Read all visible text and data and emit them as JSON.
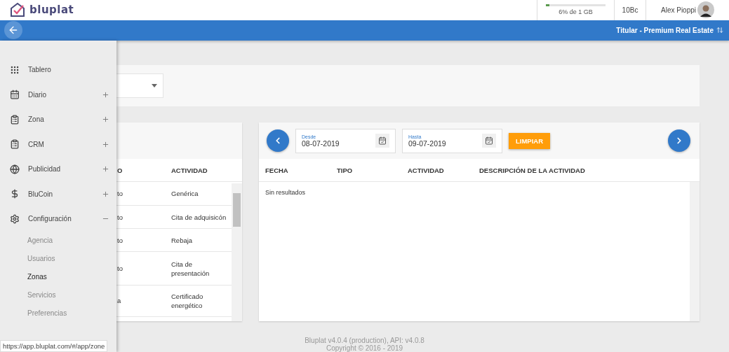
{
  "header": {
    "logo_text": "bluplat",
    "storage": {
      "label": "6% de 1 GB",
      "level": 0.06
    },
    "coins": "10Bc",
    "user": {
      "name": "Alex Pioppi"
    }
  },
  "nav_bar": {
    "title": "Titular - Premium Real Estate"
  },
  "sidebar": {
    "items": [
      {
        "label": "Tablero",
        "kind": "grid"
      },
      {
        "label": "Diario",
        "kind": "calendar",
        "expanded": false
      },
      {
        "label": "Zona",
        "kind": "clipboard",
        "expanded": false
      },
      {
        "label": "CRM",
        "kind": "clipboard",
        "expanded": false
      },
      {
        "label": "Publicidad",
        "kind": "globe",
        "expanded": false
      },
      {
        "label": "BluCoin",
        "kind": "dollar",
        "expanded": false
      },
      {
        "label": "Configuración",
        "kind": "gear",
        "expanded": true,
        "children": [
          {
            "label": "Agencia",
            "selected": false
          },
          {
            "label": "Usuarios",
            "selected": false
          },
          {
            "label": "Zonas",
            "selected": true
          },
          {
            "label": "Servicios",
            "selected": false
          },
          {
            "label": "Preferencias",
            "selected": false
          }
        ]
      }
    ]
  },
  "left_table": {
    "columns": [
      "O",
      "ACTIVIDAD"
    ],
    "rows": [
      {
        "column_1": "to",
        "actividad": "Genérica"
      },
      {
        "column_1": "to",
        "actividad": "Cita de adquisicón"
      },
      {
        "column_1": "to",
        "actividad": "Rebaja"
      },
      {
        "column_1": "to",
        "actividad": "Cita de presentación"
      },
      {
        "column_1": "a",
        "actividad": "Certificado energético"
      }
    ]
  },
  "activity_panel": {
    "date_from": {
      "label": "Desde",
      "value": "08-07-2019"
    },
    "date_to": {
      "label": "Hasta",
      "value": "09-07-2019"
    },
    "clear_button": "LIMPIAR",
    "columns": [
      "FECHA",
      "TIPO",
      "ACTIVIDAD",
      "DESCRIPCIÓN DE LA ACTIVIDAD"
    ],
    "empty_message": "Sin resultados"
  },
  "footer": {
    "version": "Bluplat v4.0.4 (production), API: v4.0.8",
    "copyright": "Copyright © 2016 - 2019"
  },
  "status_url": "https://app.bluplat.com/#/app/zone"
}
